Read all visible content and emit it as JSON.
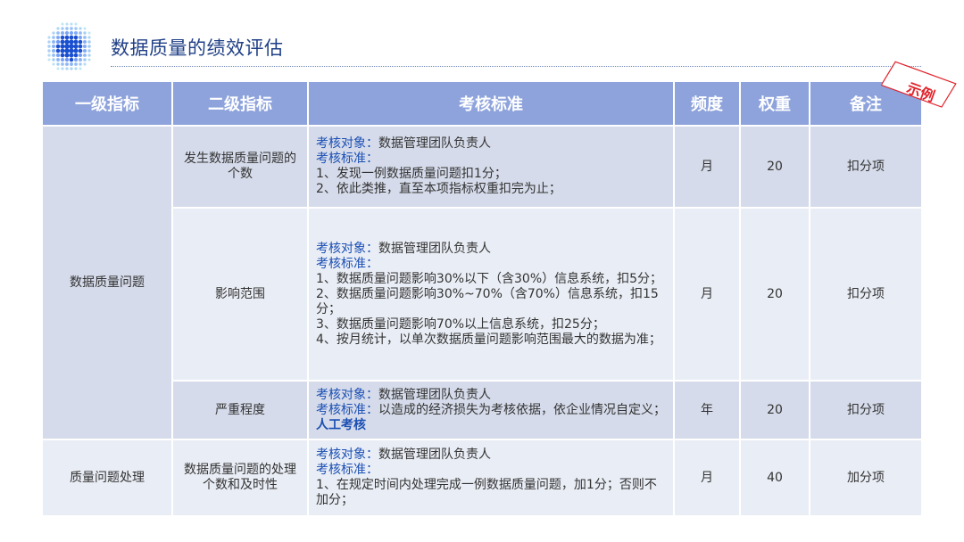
{
  "page": {
    "title": "数据质量的绩效评估",
    "stamp": "示例"
  },
  "table": {
    "headers": [
      "一级指标",
      "二级指标",
      "考核标准",
      "频度",
      "权重",
      "备注"
    ],
    "rows": [
      {
        "level1": "数据质量问题",
        "level2": "发生数据质量问题的个数",
        "object_label": "考核对象：",
        "object_value": "数据管理团队负责人",
        "criteria_label": "考核标准：",
        "criteria_lines": [
          "1、发现一例数据质量问题扣1分；",
          "2、依此类推，直至本项指标权重扣完为止；"
        ],
        "frequency": "月",
        "weight": "20",
        "note": "扣分项"
      },
      {
        "level2": "影响范围",
        "object_label": "考核对象：",
        "object_value": "数据管理团队负责人",
        "criteria_label": "考核标准：",
        "criteria_lines": [
          "1、数据质量问题影响30%以下（含30%）信息系统，扣5分；",
          "2、数据质量问题影响30%~70%（含70%）信息系统，扣15分；",
          "3、数据质量问题影响70%以上信息系统，扣25分；",
          "4、按月统计，以单次数据质量问题影响范围最大的数据为准；"
        ],
        "frequency": "月",
        "weight": "20",
        "note": "扣分项"
      },
      {
        "level2": "严重程度",
        "object_label": "考核对象：",
        "object_value": "数据管理团队负责人",
        "criteria_label": "考核标准：",
        "criteria_text": "以造成的经济损失为考核依据，依企业情况自定义；",
        "criteria_emphasis": "人工考核",
        "frequency": "年",
        "weight": "20",
        "note": "扣分项"
      },
      {
        "level1": "质量问题处理",
        "level2": "数据质量问题的处理个数和及时性",
        "object_label": "考核对象：",
        "object_value": "数据管理团队负责人",
        "criteria_label": "考核标准：",
        "criteria_lines": [
          "1、在规定时间内处理完成一例数据质量问题，加1分；否则不加分；"
        ],
        "frequency": "月",
        "weight": "40",
        "note": "加分项"
      }
    ]
  }
}
